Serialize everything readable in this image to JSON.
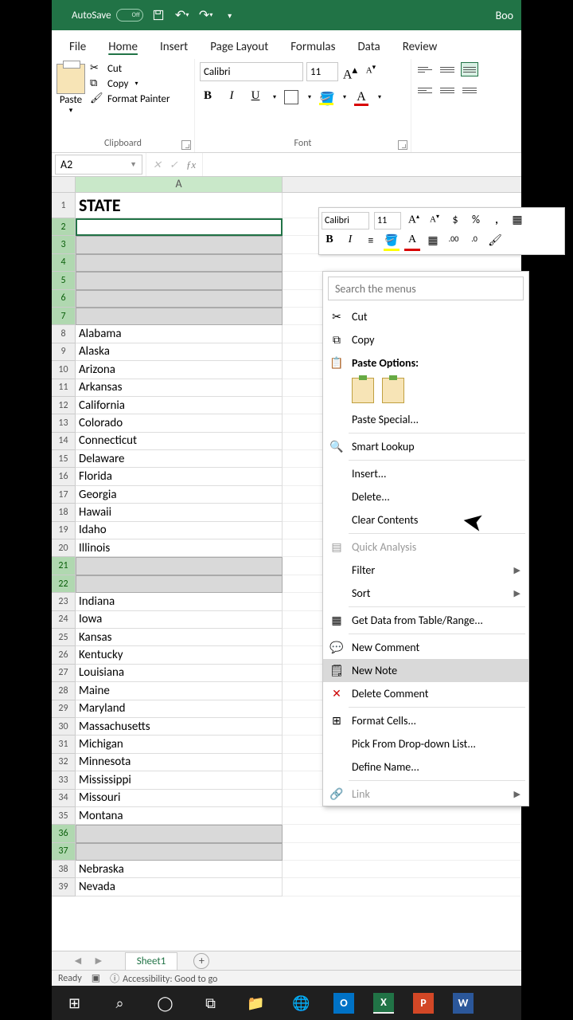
{
  "titlebar": {
    "autosave": "AutoSave",
    "autosave_state": "Off",
    "book": "Boo"
  },
  "ribbon": {
    "tabs": [
      "File",
      "Home",
      "Insert",
      "Page Layout",
      "Formulas",
      "Data",
      "Review"
    ],
    "active_tab": 1,
    "clipboard": {
      "paste": "Paste",
      "cut": "Cut",
      "copy": "Copy",
      "format_painter": "Format Painter",
      "group_label": "Clipboard"
    },
    "font": {
      "name_value": "Calibri",
      "size_value": "11",
      "group_label": "Font"
    }
  },
  "namebox_value": "A2",
  "mini_toolbar": {
    "font": "Calibri",
    "size": "11"
  },
  "context": {
    "search_placeholder": "Search the menus",
    "cut": "Cut",
    "copy": "Copy",
    "paste_options": "Paste Options:",
    "paste_special": "Paste Special...",
    "smart_lookup": "Smart Lookup",
    "insert": "Insert...",
    "delete": "Delete...",
    "clear_contents": "Clear Contents",
    "quick_analysis": "Quick Analysis",
    "filter": "Filter",
    "sort": "Sort",
    "get_data": "Get Data from Table/Range...",
    "new_comment": "New Comment",
    "new_note": "New Note",
    "delete_comment": "Delete Comment",
    "format_cells": "Format Cells...",
    "pick_list": "Pick From Drop-down List...",
    "define_name": "Define Name...",
    "link": "Link"
  },
  "grid": {
    "col_a_label": "A",
    "header_cell": "STATE",
    "rows": [
      {
        "num": 1,
        "val": "STATE",
        "header": true
      },
      {
        "num": 2,
        "val": "",
        "sel": "active"
      },
      {
        "num": 3,
        "val": "",
        "sel": "area"
      },
      {
        "num": 4,
        "val": "",
        "sel": "area"
      },
      {
        "num": 5,
        "val": "",
        "sel": "area"
      },
      {
        "num": 6,
        "val": "",
        "sel": "area"
      },
      {
        "num": 7,
        "val": "",
        "sel": "area"
      },
      {
        "num": 8,
        "val": "Alabama"
      },
      {
        "num": 9,
        "val": "Alaska"
      },
      {
        "num": 10,
        "val": "Arizona"
      },
      {
        "num": 11,
        "val": "Arkansas"
      },
      {
        "num": 12,
        "val": "California"
      },
      {
        "num": 13,
        "val": "Colorado"
      },
      {
        "num": 14,
        "val": "Connecticut"
      },
      {
        "num": 15,
        "val": "Delaware"
      },
      {
        "num": 16,
        "val": "Florida"
      },
      {
        "num": 17,
        "val": "Georgia"
      },
      {
        "num": 18,
        "val": "Hawaii"
      },
      {
        "num": 19,
        "val": "Idaho"
      },
      {
        "num": 20,
        "val": "Illinois"
      },
      {
        "num": 21,
        "val": "",
        "sel": "area"
      },
      {
        "num": 22,
        "val": "",
        "sel": "area"
      },
      {
        "num": 23,
        "val": "Indiana"
      },
      {
        "num": 24,
        "val": "Iowa"
      },
      {
        "num": 25,
        "val": "Kansas"
      },
      {
        "num": 26,
        "val": "Kentucky"
      },
      {
        "num": 27,
        "val": "Louisiana"
      },
      {
        "num": 28,
        "val": "Maine"
      },
      {
        "num": 29,
        "val": "Maryland"
      },
      {
        "num": 30,
        "val": "Massachusetts"
      },
      {
        "num": 31,
        "val": "Michigan"
      },
      {
        "num": 32,
        "val": "Minnesota"
      },
      {
        "num": 33,
        "val": "Mississippi"
      },
      {
        "num": 34,
        "val": "Missouri"
      },
      {
        "num": 35,
        "val": "Montana"
      },
      {
        "num": 36,
        "val": "",
        "sel": "area"
      },
      {
        "num": 37,
        "val": "",
        "sel": "area"
      },
      {
        "num": 38,
        "val": "Nebraska"
      },
      {
        "num": 39,
        "val": "Nevada"
      }
    ]
  },
  "sheet_tab": "Sheet1",
  "status": {
    "ready": "Ready",
    "accessibility": "Accessibility: Good to go"
  }
}
